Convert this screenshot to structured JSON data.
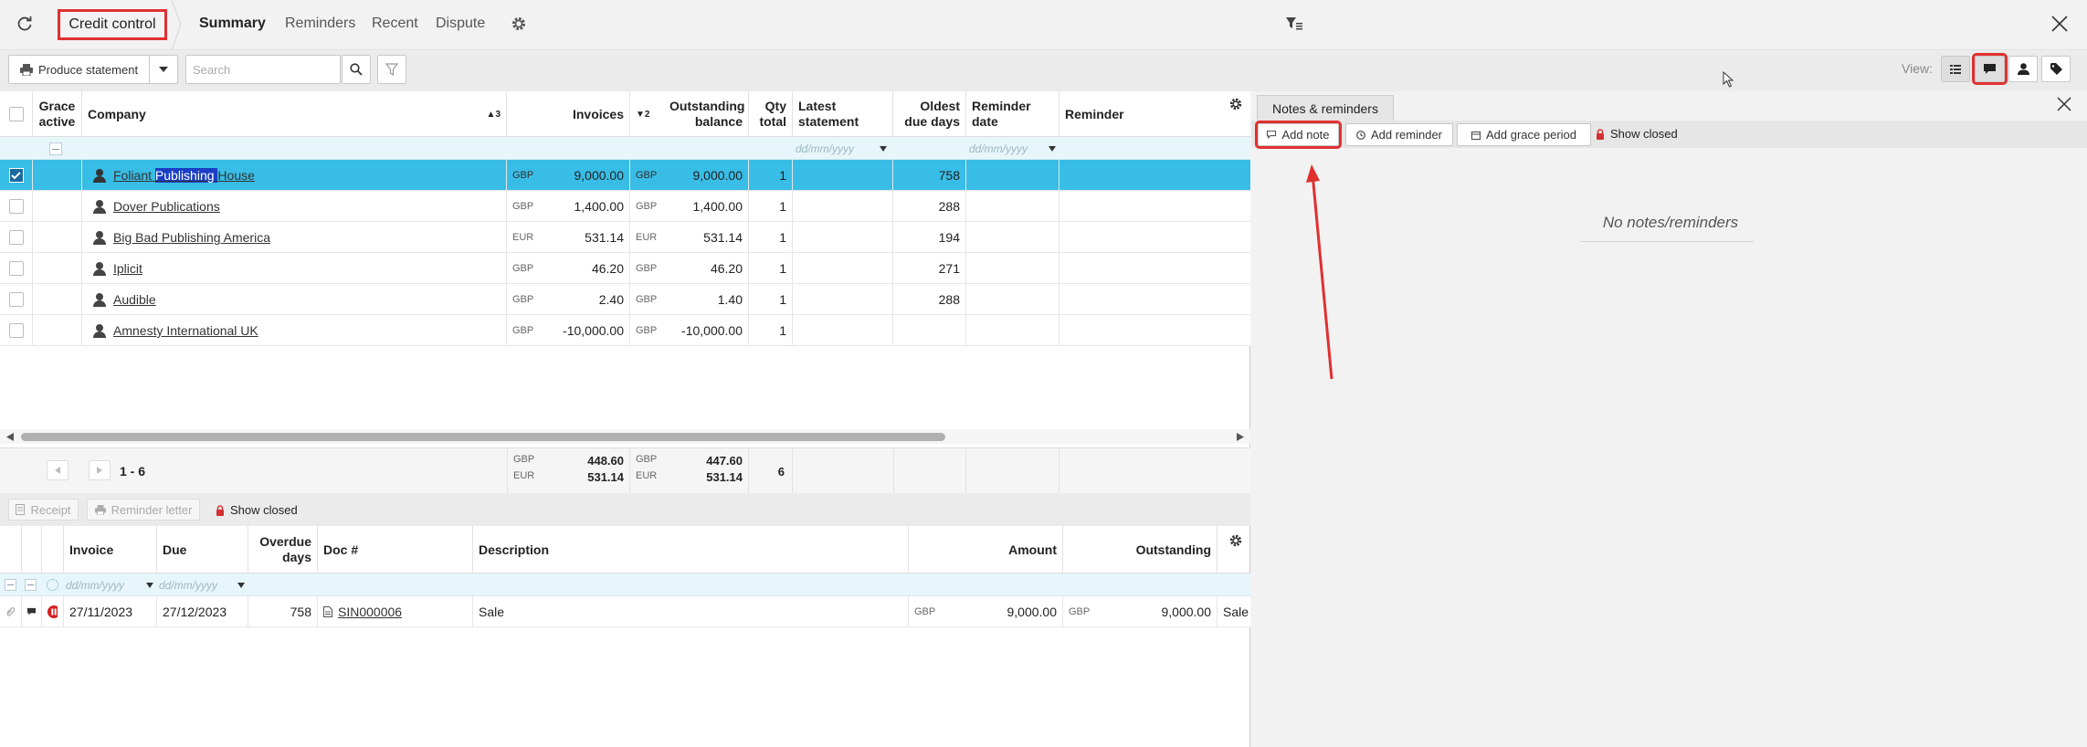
{
  "topbar": {
    "title": "Credit control",
    "tabs": [
      {
        "label": "Summary",
        "active": true
      },
      {
        "label": "Reminders",
        "active": false
      },
      {
        "label": "Recent",
        "active": false
      },
      {
        "label": "Dispute",
        "active": false
      }
    ]
  },
  "toolbar": {
    "produce_statement": "Produce statement",
    "search_placeholder": "Search",
    "view_label": "View:"
  },
  "grid": {
    "columns": {
      "grace_active": "Grace active",
      "company": "Company",
      "company_sort": "3",
      "invoices": "Invoices",
      "outstanding_sort": "2",
      "outstanding_balance": "Outstanding balance",
      "qty_total": "Qty total",
      "latest_statement": "Latest statement",
      "oldest_due_days": "Oldest due days",
      "reminder_date": "Reminder date",
      "reminder": "Reminder"
    },
    "date_placeholder": "dd/mm/yyyy",
    "rows": [
      {
        "company_a": "Foliant ",
        "company_b": "Publishing ",
        "company_c": "House",
        "inv_cur": "GBP",
        "invoices": "9,000.00",
        "out_cur": "GBP",
        "outstanding": "9,000.00",
        "qty": "1",
        "oldest": "758",
        "selected": true
      },
      {
        "company": "Dover Publications",
        "inv_cur": "GBP",
        "invoices": "1,400.00",
        "out_cur": "GBP",
        "outstanding": "1,400.00",
        "qty": "1",
        "oldest": "288"
      },
      {
        "company": "Big Bad Publishing America",
        "inv_cur": "EUR",
        "invoices": "531.14",
        "out_cur": "EUR",
        "outstanding": "531.14",
        "qty": "1",
        "oldest": "194"
      },
      {
        "company": "Iplicit",
        "inv_cur": "GBP",
        "invoices": "46.20",
        "out_cur": "GBP",
        "outstanding": "46.20",
        "qty": "1",
        "oldest": "271"
      },
      {
        "company": "Audible",
        "inv_cur": "GBP",
        "invoices": "2.40",
        "out_cur": "GBP",
        "outstanding": "1.40",
        "qty": "1",
        "oldest": "288"
      },
      {
        "company": "Amnesty International UK",
        "inv_cur": "GBP",
        "invoices": "-10,000.00",
        "out_cur": "GBP",
        "outstanding": "-10,000.00",
        "qty": "1",
        "oldest": ""
      }
    ],
    "footer": {
      "range": "1 - 6",
      "inv_gbp_cur": "GBP",
      "inv_gbp": "448.60",
      "inv_eur_cur": "EUR",
      "inv_eur": "531.14",
      "out_gbp_cur": "GBP",
      "out_gbp": "447.60",
      "out_eur_cur": "EUR",
      "out_eur": "531.14",
      "qty": "6"
    }
  },
  "lower_toolbar": {
    "receipt": "Receipt",
    "reminder_letter": "Reminder letter",
    "show_closed": "Show closed"
  },
  "invoice_grid": {
    "columns": {
      "invoice": "Invoice",
      "due": "Due",
      "overdue_days": "Overdue days",
      "doc": "Doc #",
      "description": "Description",
      "amount": "Amount",
      "outstanding": "Outstanding"
    },
    "rows": [
      {
        "invoice": "27/11/2023",
        "due": "27/12/2023",
        "overdue": "758",
        "doc": "SIN000006",
        "description": "Sale",
        "amt_cur": "GBP",
        "amount": "9,000.00",
        "out_cur": "GBP",
        "outstanding": "9,000.00",
        "extra": "Sale"
      }
    ]
  },
  "notes_panel": {
    "tab": "Notes & reminders",
    "add_note": "Add note",
    "add_reminder": "Add reminder",
    "add_grace_period": "Add grace period",
    "show_closed": "Show closed",
    "empty_message": "No notes/reminders"
  },
  "colors": {
    "selected_row": "#38bde6",
    "highlight_box": "#e03030",
    "filter_row": "#e6f6fb"
  }
}
